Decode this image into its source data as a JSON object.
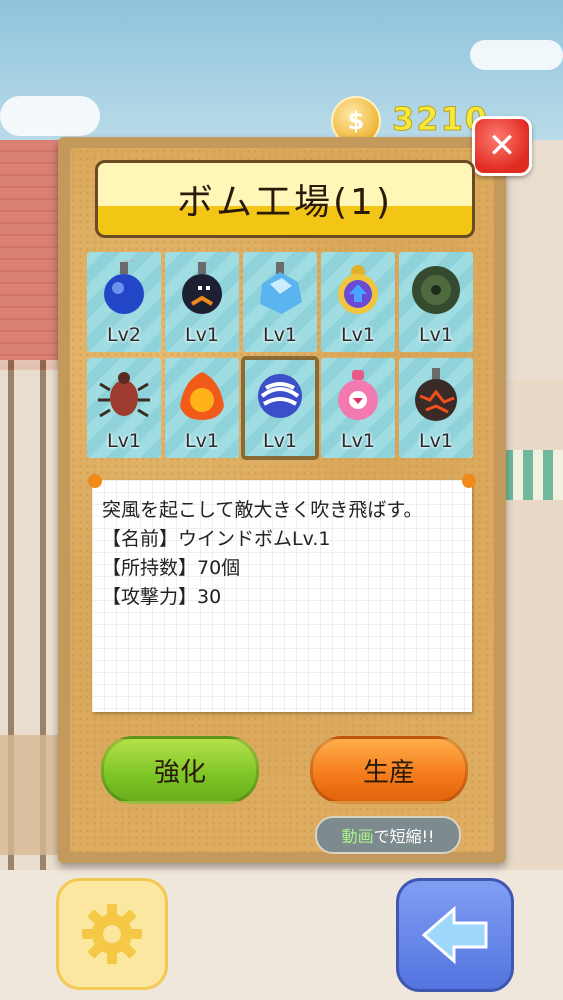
{
  "currency": {
    "symbol": "$",
    "amount": "3210"
  },
  "dialog": {
    "title": "ボム工場(1)",
    "close_icon": "close-icon"
  },
  "bombs": [
    {
      "name": "blue-bomb",
      "level": "Lv2",
      "selected": false
    },
    {
      "name": "black-bomb",
      "level": "Lv1",
      "selected": false
    },
    {
      "name": "ice-bomb",
      "level": "Lv1",
      "selected": false
    },
    {
      "name": "arrow-bomb",
      "level": "Lv1",
      "selected": false
    },
    {
      "name": "green-mine-bomb",
      "level": "Lv1",
      "selected": false
    },
    {
      "name": "bug-bomb",
      "level": "Lv1",
      "selected": false
    },
    {
      "name": "fire-bomb",
      "level": "Lv1",
      "selected": false
    },
    {
      "name": "wind-bomb",
      "level": "Lv1",
      "selected": true
    },
    {
      "name": "pink-bomb",
      "level": "Lv1",
      "selected": false
    },
    {
      "name": "magma-bomb",
      "level": "Lv1",
      "selected": false
    }
  ],
  "detail": {
    "description": "突風を起こして敵大きく吹き飛ばす。",
    "name_line": "【名前】ウインドボムLv.1",
    "count_line": "【所持数】70個",
    "attack_line": "【攻撃力】30"
  },
  "buttons": {
    "upgrade": "強化",
    "produce": "生産",
    "video_highlight": "動画",
    "video_rest": "で短縮!!"
  },
  "footer": {
    "settings_icon": "gear-icon",
    "back_icon": "back-arrow-icon"
  },
  "colors": {
    "accent_green": "#7cc526",
    "accent_orange": "#f47a1a",
    "close_red": "#e02b22"
  }
}
